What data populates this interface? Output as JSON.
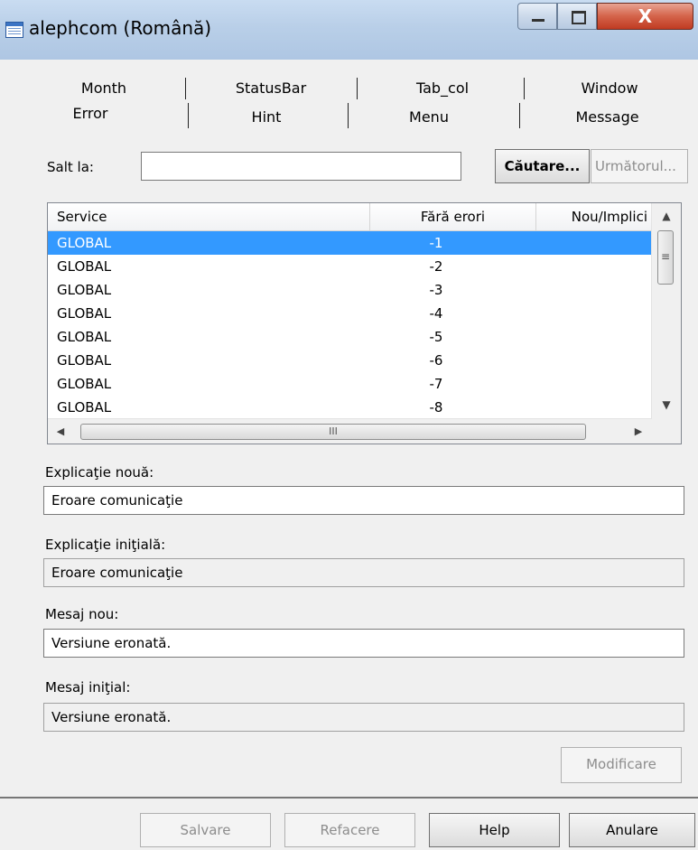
{
  "window": {
    "title": "alephcom  (Română)",
    "close_glyph": "X"
  },
  "tabs_row1": [
    "Month",
    "StatusBar",
    "Tab_col",
    "Window"
  ],
  "tabs_row2": [
    "Error",
    "Hint",
    "Menu",
    "Message"
  ],
  "search": {
    "label": "Salt la:",
    "value": "",
    "search_button": "Căutare...",
    "next_button": "Următorul..."
  },
  "list": {
    "headers": [
      "Service",
      "Fără erori",
      "Nou/Implici"
    ],
    "rows": [
      {
        "service": "GLOBAL",
        "code": "-1",
        "selected": true
      },
      {
        "service": "GLOBAL",
        "code": "-2"
      },
      {
        "service": "GLOBAL",
        "code": "-3"
      },
      {
        "service": "GLOBAL",
        "code": "-4"
      },
      {
        "service": "GLOBAL",
        "code": "-5"
      },
      {
        "service": "GLOBAL",
        "code": "-6"
      },
      {
        "service": "GLOBAL",
        "code": "-7"
      },
      {
        "service": "GLOBAL",
        "code": "-8"
      }
    ]
  },
  "fields": {
    "new_explanation_label": "Explicaţie nouă:",
    "new_explanation_value": "Eroare comunicaţie",
    "initial_explanation_label": "Explicaţie iniţială:",
    "initial_explanation_value": "Eroare comunicaţie",
    "new_message_label": "Mesaj nou:",
    "new_message_value": "Versiune eronată.",
    "initial_message_label": "Mesaj iniţial:",
    "initial_message_value": "Versiune eronată."
  },
  "buttons": {
    "modify": "Modificare",
    "save": "Salvare",
    "undo": "Refacere",
    "help": "Help",
    "cancel": "Anulare"
  },
  "colors": {
    "selection": "#3399ff",
    "title_bar": "#b9cfe8",
    "close_button": "#c03b22"
  }
}
